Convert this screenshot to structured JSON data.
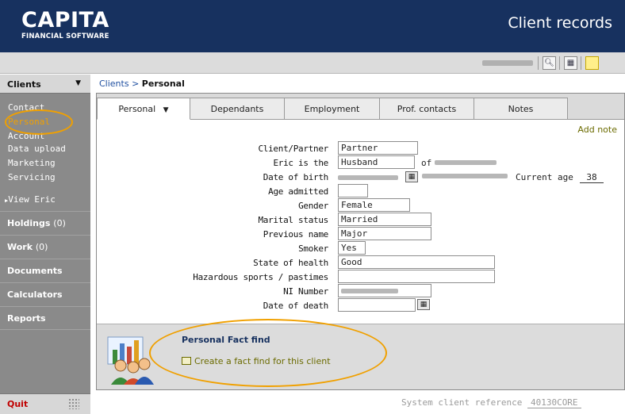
{
  "header": {
    "brand_name": "CAPITA",
    "brand_sub": "FINANCIAL SOFTWARE",
    "title": "Client records"
  },
  "toolbar": {
    "icons": [
      "search-records-icon",
      "grid-view-icon",
      "sticky-note-icon"
    ]
  },
  "sidebar": {
    "section": "Clients",
    "sub_items": [
      "Contact",
      "Personal",
      "Account",
      "Data upload",
      "Marketing",
      "Servicing"
    ],
    "active_item": "Personal",
    "view_label": "View Eric",
    "items": [
      {
        "label": "Holdings",
        "count": "(0)"
      },
      {
        "label": "Work",
        "count": "(0)"
      },
      {
        "label": "Documents",
        "count": ""
      },
      {
        "label": "Calculators",
        "count": ""
      },
      {
        "label": "Reports",
        "count": ""
      }
    ],
    "quit_label": "Quit"
  },
  "breadcrumb": {
    "root": "Clients",
    "separator": " > ",
    "current": "Personal"
  },
  "tabs": [
    {
      "label": "Personal",
      "active": true,
      "caret": "▼"
    },
    {
      "label": "Dependants",
      "active": false
    },
    {
      "label": "Employment",
      "active": false
    },
    {
      "label": "Prof. contacts",
      "active": false
    },
    {
      "label": "Notes",
      "active": false
    }
  ],
  "form": {
    "add_note": "Add note",
    "client_partner_label": "Client/Partner",
    "client_partner_value": "Partner",
    "relation_label": "Eric is the",
    "relation_value": "Husband",
    "relation_of": "of",
    "dob_label": "Date of birth",
    "current_age_label": "Current age",
    "current_age_value": "38",
    "age_admitted_label": "Age admitted",
    "age_admitted_value": "",
    "gender_label": "Gender",
    "gender_value": "Female",
    "marital_label": "Marital status",
    "marital_value": "Married",
    "prev_name_label": "Previous name",
    "prev_name_value": "Major",
    "smoker_label": "Smoker",
    "smoker_value": "Yes",
    "health_label": "State of health",
    "health_value": "Good",
    "hazard_label": "Hazardous sports / pastimes",
    "hazard_value": "",
    "ni_label": "NI Number",
    "dod_label": "Date of death",
    "dod_value": ""
  },
  "fact_find": {
    "title": "Personal Fact find",
    "link": "Create a fact find for this client"
  },
  "system_ref": {
    "label": "System client reference",
    "value": "40130CORE"
  },
  "colors": {
    "header_bg": "#17315f",
    "sidebar_bg": "#8a8a8a",
    "highlight": "#f0a000",
    "link_olive": "#6b6b00"
  }
}
